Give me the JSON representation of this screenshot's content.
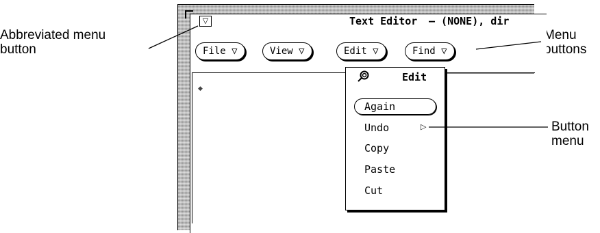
{
  "window": {
    "menu_button_glyph": "▽",
    "title": "Text Editor",
    "title_suffix": "– (NONE), dir"
  },
  "menu_buttons": [
    {
      "label": "File ▽"
    },
    {
      "label": "View ▽"
    },
    {
      "label": "Edit ▽"
    },
    {
      "label": "Find ▽"
    }
  ],
  "popup": {
    "title": "Edit",
    "pin_icon": "pushpin-icon",
    "items": [
      {
        "label": "Again",
        "default": true
      },
      {
        "label": "Undo",
        "submenu": true
      },
      {
        "label": "Copy"
      },
      {
        "label": "Paste"
      },
      {
        "label": "Cut"
      }
    ],
    "submenu_glyph": "▷"
  },
  "callouts": {
    "abbrev_menu": "Abbreviated menu\nbutton",
    "menu_buttons": "Menu\nbuttons",
    "button_menu": "Button\nmenu"
  }
}
